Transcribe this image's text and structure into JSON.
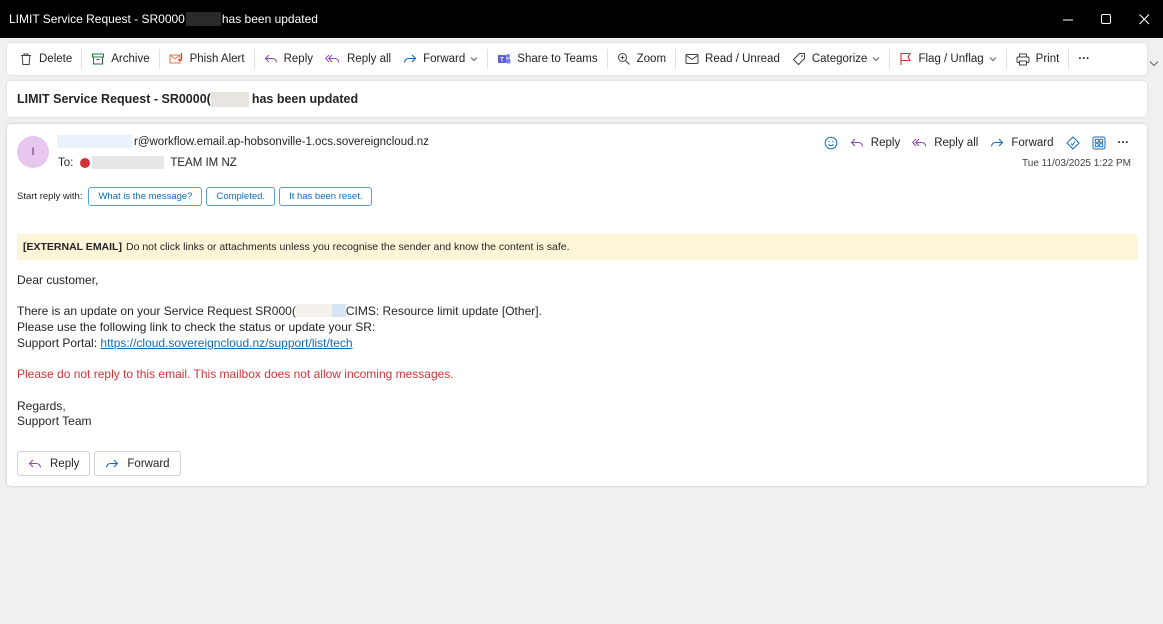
{
  "window": {
    "title_prefix": "LIMIT Service Request - SR0000",
    "title_suffix": "has been updated"
  },
  "toolbar": {
    "delete": "Delete",
    "archive": "Archive",
    "phish_alert": "Phish Alert",
    "reply": "Reply",
    "reply_all": "Reply all",
    "forward": "Forward",
    "share_to_teams": "Share to Teams",
    "zoom": "Zoom",
    "read_unread": "Read / Unread",
    "categorize": "Categorize",
    "flag_unflag": "Flag / Unflag",
    "print": "Print",
    "more": "···"
  },
  "subject": {
    "prefix": "LIMIT Service Request - SR0000(",
    "suffix": "has been updated"
  },
  "message": {
    "avatar_initial": "I",
    "from_email": "r@workflow.email.ap-hobsonville-1.ocs.sovereigncloud.nz",
    "to_label": "To:",
    "to_recipient": "TEAM IM NZ",
    "date": "Tue 11/03/2025 1:22 PM",
    "actions": {
      "reply": "Reply",
      "reply_all": "Reply all",
      "forward": "Forward",
      "more": "···"
    },
    "quick_reply": {
      "label": "Start reply with:",
      "options": [
        "What is the message?",
        "Completed.",
        "It has been reset."
      ]
    },
    "banner": {
      "tag": "[EXTERNAL EMAIL]",
      "text": "Do not click links or attachments unless you recognise the sender and know the content is safe."
    },
    "body": {
      "greeting": "Dear customer,",
      "line1_prefix": "There is an update on your Service Request SR000(",
      "line1_suffix": "CIMS: Resource limit update [Other].",
      "line2": "Please use the following link to check the status or update your SR:",
      "portal_label": "Support Portal:",
      "portal_link": "https://cloud.sovereigncloud.nz/support/list/tech",
      "warning": "Please do not reply to this email. This mailbox does not allow incoming messages.",
      "regards": "Regards,",
      "signature": "Support Team"
    },
    "bottom": {
      "reply": "Reply",
      "forward": "Forward"
    }
  },
  "colors": {
    "accent": "#0f6cbd",
    "warning_red": "#d13438",
    "banner_bg": "#fdf5d8",
    "avatar_bg": "#e7c6f0",
    "reply_purple": "#8a4ca8"
  }
}
